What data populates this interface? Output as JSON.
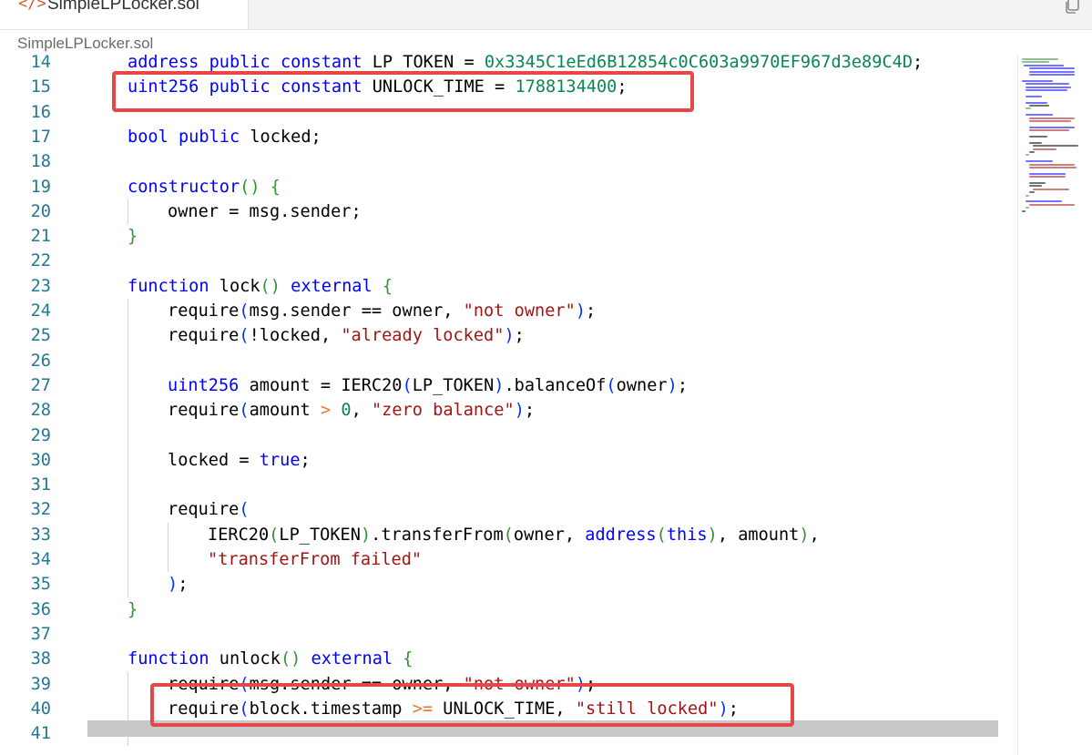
{
  "tab": {
    "icon": "code-icon",
    "icon_glyph": "</>",
    "title": "SimpleLPLocker.sol"
  },
  "breadcrumb": "SimpleLPLocker.sol",
  "toolbar": {
    "copy_icon": "copy-icon"
  },
  "colors": {
    "keyword": "#0000ff",
    "number": "#098658",
    "string": "#a31515",
    "paren_level1": "#319331",
    "paren_level2": "#0431fa",
    "operator": "#e37933",
    "line_number": "#237893",
    "highlight_box": "#e8474a"
  },
  "code_lines": [
    {
      "n": "14",
      "indent": 1,
      "tokens": [
        [
          "kw",
          "address"
        ],
        [
          "id",
          " "
        ],
        [
          "kw",
          "public"
        ],
        [
          "id",
          " "
        ],
        [
          "kw",
          "constant"
        ],
        [
          "id",
          " LP_TOKEN = "
        ],
        [
          "hexn",
          "0x3345C1eEd6B12854c0C603a9970EF967d3e89C4D"
        ],
        [
          "id",
          ";"
        ]
      ]
    },
    {
      "n": "15",
      "indent": 1,
      "tokens": [
        [
          "kw",
          "uint256"
        ],
        [
          "id",
          " "
        ],
        [
          "kw",
          "public"
        ],
        [
          "id",
          " "
        ],
        [
          "kw",
          "constant"
        ],
        [
          "id",
          " UNLOCK_TIME = "
        ],
        [
          "num",
          "1788134400"
        ],
        [
          "id",
          ";"
        ]
      ]
    },
    {
      "n": "16",
      "indent": 0,
      "tokens": []
    },
    {
      "n": "17",
      "indent": 1,
      "tokens": [
        [
          "kw",
          "bool"
        ],
        [
          "id",
          " "
        ],
        [
          "kw",
          "public"
        ],
        [
          "id",
          " locked;"
        ]
      ]
    },
    {
      "n": "18",
      "indent": 0,
      "tokens": []
    },
    {
      "n": "19",
      "indent": 1,
      "tokens": [
        [
          "kw",
          "constructor"
        ],
        [
          "pg",
          "()"
        ],
        [
          "id",
          " "
        ],
        [
          "pg",
          "{"
        ]
      ]
    },
    {
      "n": "20",
      "indent": 2,
      "tokens": [
        [
          "id",
          "owner = msg.sender;"
        ]
      ]
    },
    {
      "n": "21",
      "indent": 1,
      "tokens": [
        [
          "pg",
          "}"
        ]
      ]
    },
    {
      "n": "22",
      "indent": 0,
      "tokens": []
    },
    {
      "n": "23",
      "indent": 1,
      "tokens": [
        [
          "kw",
          "function"
        ],
        [
          "id",
          " lock"
        ],
        [
          "pg",
          "()"
        ],
        [
          "id",
          " "
        ],
        [
          "kw",
          "external"
        ],
        [
          "id",
          " "
        ],
        [
          "pg",
          "{"
        ]
      ]
    },
    {
      "n": "24",
      "indent": 2,
      "tokens": [
        [
          "id",
          "require"
        ],
        [
          "pb",
          "("
        ],
        [
          "id",
          "msg.sender == owner, "
        ],
        [
          "str",
          "\"not owner\""
        ],
        [
          "pb",
          ")"
        ],
        [
          "id",
          ";"
        ]
      ]
    },
    {
      "n": "25",
      "indent": 2,
      "tokens": [
        [
          "id",
          "require"
        ],
        [
          "pb",
          "("
        ],
        [
          "id",
          "!locked, "
        ],
        [
          "str",
          "\"already locked\""
        ],
        [
          "pb",
          ")"
        ],
        [
          "id",
          ";"
        ]
      ]
    },
    {
      "n": "26",
      "indent": 0,
      "tokens": []
    },
    {
      "n": "27",
      "indent": 2,
      "tokens": [
        [
          "kw",
          "uint256"
        ],
        [
          "id",
          " amount = IERC20"
        ],
        [
          "pb",
          "("
        ],
        [
          "id",
          "LP_TOKEN"
        ],
        [
          "pb",
          ")"
        ],
        [
          "id",
          ".balanceOf"
        ],
        [
          "pb",
          "("
        ],
        [
          "id",
          "owner"
        ],
        [
          "pb",
          ")"
        ],
        [
          "id",
          ";"
        ]
      ]
    },
    {
      "n": "28",
      "indent": 2,
      "tokens": [
        [
          "id",
          "require"
        ],
        [
          "pb",
          "("
        ],
        [
          "id",
          "amount "
        ],
        [
          "op",
          ">"
        ],
        [
          "id",
          " "
        ],
        [
          "num",
          "0"
        ],
        [
          "id",
          ", "
        ],
        [
          "str",
          "\"zero balance\""
        ],
        [
          "pb",
          ")"
        ],
        [
          "id",
          ";"
        ]
      ]
    },
    {
      "n": "29",
      "indent": 0,
      "tokens": []
    },
    {
      "n": "30",
      "indent": 2,
      "tokens": [
        [
          "id",
          "locked = "
        ],
        [
          "kw",
          "true"
        ],
        [
          "id",
          ";"
        ]
      ]
    },
    {
      "n": "31",
      "indent": 0,
      "tokens": []
    },
    {
      "n": "32",
      "indent": 2,
      "tokens": [
        [
          "id",
          "require"
        ],
        [
          "pb",
          "("
        ]
      ]
    },
    {
      "n": "33",
      "indent": 3,
      "tokens": [
        [
          "id",
          "IERC20"
        ],
        [
          "pg",
          "("
        ],
        [
          "id",
          "LP_TOKEN"
        ],
        [
          "pg",
          ")"
        ],
        [
          "id",
          ".transferFrom"
        ],
        [
          "pg",
          "("
        ],
        [
          "id",
          "owner, "
        ],
        [
          "kw",
          "address"
        ],
        [
          "pg",
          "("
        ],
        [
          "kw",
          "this"
        ],
        [
          "pg",
          ")"
        ],
        [
          "id",
          ", amount"
        ],
        [
          "pg",
          ")"
        ],
        [
          "id",
          ","
        ]
      ]
    },
    {
      "n": "34",
      "indent": 3,
      "tokens": [
        [
          "str",
          "\"transferFrom failed\""
        ]
      ]
    },
    {
      "n": "35",
      "indent": 2,
      "tokens": [
        [
          "pb",
          ")"
        ],
        [
          "id",
          ";"
        ]
      ]
    },
    {
      "n": "36",
      "indent": 1,
      "tokens": [
        [
          "pg",
          "}"
        ]
      ]
    },
    {
      "n": "37",
      "indent": 0,
      "tokens": []
    },
    {
      "n": "38",
      "indent": 1,
      "tokens": [
        [
          "kw",
          "function"
        ],
        [
          "id",
          " unlock"
        ],
        [
          "pg",
          "()"
        ],
        [
          "id",
          " "
        ],
        [
          "kw",
          "external"
        ],
        [
          "id",
          " "
        ],
        [
          "pg",
          "{"
        ]
      ]
    },
    {
      "n": "39",
      "indent": 2,
      "tokens": [
        [
          "id",
          "require"
        ],
        [
          "pb",
          "("
        ],
        [
          "id",
          "msg.sender == owner, "
        ],
        [
          "str",
          "\"not owner\""
        ],
        [
          "pb",
          ")"
        ],
        [
          "id",
          ";"
        ]
      ]
    },
    {
      "n": "40",
      "indent": 2,
      "tokens": [
        [
          "id",
          "require"
        ],
        [
          "pb",
          "("
        ],
        [
          "id",
          "block.timestamp "
        ],
        [
          "op",
          ">="
        ],
        [
          "id",
          " UNLOCK_TIME, "
        ],
        [
          "str",
          "\"still locked\""
        ],
        [
          "pb",
          ")"
        ],
        [
          "id",
          ";"
        ]
      ]
    },
    {
      "n": "41",
      "indent": 0,
      "tokens": []
    }
  ]
}
